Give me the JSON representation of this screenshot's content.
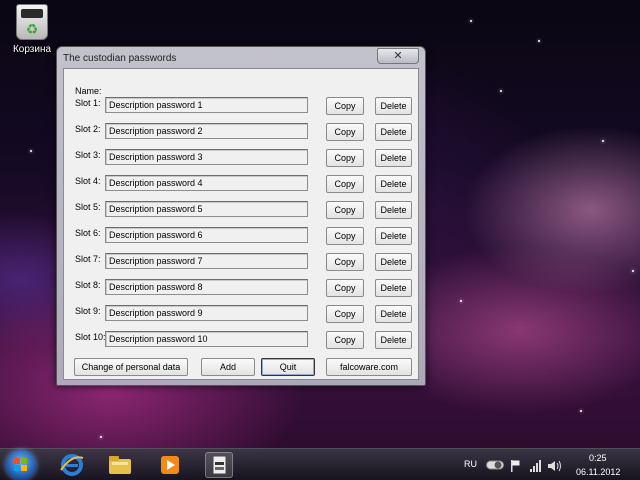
{
  "desktop": {
    "recycle_bin_label": "Корзина",
    "recycle_bin_icon": "recycle-bin-icon"
  },
  "window": {
    "title": "The custodian passwords",
    "close_glyph": "✕",
    "name_label": "Name:",
    "copy_label": "Copy",
    "delete_label": "Delete",
    "slots": [
      {
        "label": "Slot 1:",
        "value": "Description password 1"
      },
      {
        "label": "Slot 2:",
        "value": "Description password 2"
      },
      {
        "label": "Slot 3:",
        "value": "Description password 3"
      },
      {
        "label": "Slot 4:",
        "value": "Description password 4"
      },
      {
        "label": "Slot 5:",
        "value": "Description password 5"
      },
      {
        "label": "Slot 6:",
        "value": "Description password 6"
      },
      {
        "label": "Slot 7:",
        "value": "Description password 7"
      },
      {
        "label": "Slot 8:",
        "value": "Description password 8"
      },
      {
        "label": "Slot 9:",
        "value": "Description password 9"
      },
      {
        "label": "Slot 10:",
        "value": "Description password 10"
      }
    ],
    "buttons": {
      "change": "Change of personal data",
      "add": "Add",
      "quit": "Quit",
      "site": "falcoware.com"
    }
  },
  "taskbar": {
    "icons": [
      "start-orb-icon",
      "internet-explorer-icon",
      "file-explorer-icon",
      "media-player-icon",
      "password-app-icon"
    ],
    "language": "RU",
    "time": "0:25",
    "date": "06.11.2012",
    "colors": {
      "start_orb": "#1a4f9c",
      "ie_blue": "#2a7fd8",
      "folder_yellow": "#e8c14a",
      "media_orange": "#f28a1a"
    }
  }
}
